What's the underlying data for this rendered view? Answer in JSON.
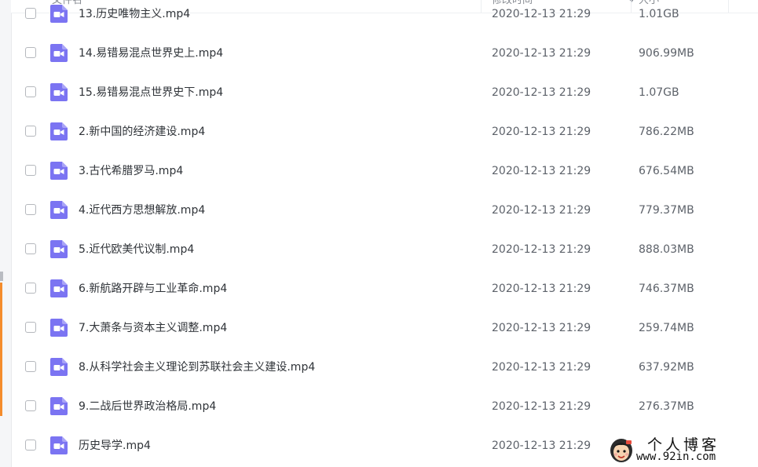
{
  "header": {
    "name_label": "文件名",
    "modified_label": "修改时间",
    "size_label": "大小"
  },
  "files": [
    {
      "name": "13.历史唯物主义.mp4",
      "modified": "2020-12-13 21:29",
      "size": "1.01GB"
    },
    {
      "name": "14.易错易混点世界史上.mp4",
      "modified": "2020-12-13 21:29",
      "size": "906.99MB"
    },
    {
      "name": "15.易错易混点世界史下.mp4",
      "modified": "2020-12-13 21:29",
      "size": "1.07GB"
    },
    {
      "name": "2.新中国的经济建设.mp4",
      "modified": "2020-12-13 21:29",
      "size": "786.22MB"
    },
    {
      "name": "3.古代希腊罗马.mp4",
      "modified": "2020-12-13 21:29",
      "size": "676.54MB"
    },
    {
      "name": "4.近代西方思想解放.mp4",
      "modified": "2020-12-13 21:29",
      "size": "779.37MB"
    },
    {
      "name": "5.近代欧美代议制.mp4",
      "modified": "2020-12-13 21:29",
      "size": "888.03MB"
    },
    {
      "name": "6.新航路开辟与工业革命.mp4",
      "modified": "2020-12-13 21:29",
      "size": "746.37MB"
    },
    {
      "name": "7.大萧条与资本主义调整.mp4",
      "modified": "2020-12-13 21:29",
      "size": "259.74MB"
    },
    {
      "name": "8.从科学社会主义理论到苏联社会主义建设.mp4",
      "modified": "2020-12-13 21:29",
      "size": "637.92MB"
    },
    {
      "name": "9.二战后世界政治格局.mp4",
      "modified": "2020-12-13 21:29",
      "size": "276.37MB"
    },
    {
      "name": "历史导学.mp4",
      "modified": "2020-12-13 21:29",
      "size": ""
    }
  ],
  "icons": {
    "file_type": "video-file-icon",
    "checkbox": "checkbox",
    "sort": "sort-descending-icon"
  },
  "colors": {
    "video_icon": "#7b74f2",
    "accent_strip": "#f48c2c"
  },
  "watermark": {
    "title": "个人博客",
    "url": "www.92in.com"
  }
}
